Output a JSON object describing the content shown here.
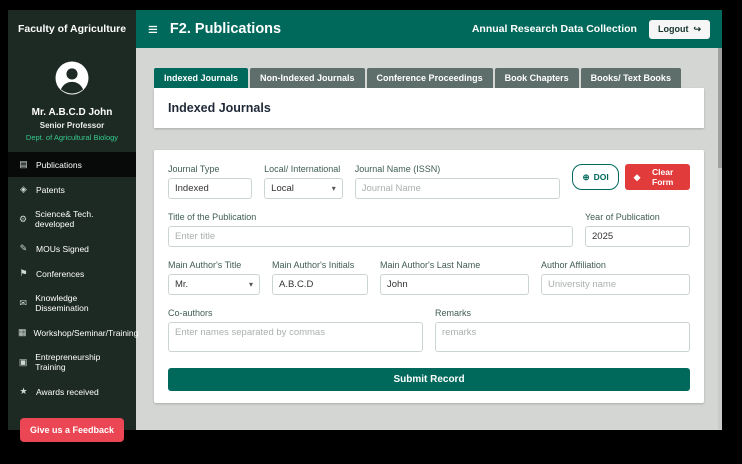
{
  "header": {
    "brand": "Faculty of Agriculture",
    "menu_icon_glyph": "≡",
    "title": "F2. Publications",
    "subtitle": "Annual Research Data Collection",
    "logout": {
      "label": "Logout",
      "icon_glyph": "↪"
    }
  },
  "sidebar": {
    "user": {
      "name": "Mr. A.B.C.D John",
      "role": "Senior Professor",
      "dept": "Dept. of Agricultural Biology"
    },
    "items": [
      {
        "label": "Publications",
        "glyph": "▤"
      },
      {
        "label": "Patents",
        "glyph": "◈"
      },
      {
        "label": "Science& Tech. developed",
        "glyph": "⚙"
      },
      {
        "label": "MOUs Signed",
        "glyph": "✎"
      },
      {
        "label": "Conferences",
        "glyph": "⚑"
      },
      {
        "label": "Knowledge Dissemination",
        "glyph": "✉"
      },
      {
        "label": "Workshop/Seminar/Training",
        "glyph": "▦"
      },
      {
        "label": "Entrepreneurship Training",
        "glyph": "▣"
      },
      {
        "label": "Awards received",
        "glyph": "★"
      }
    ],
    "feedback_label": "Give us a Feedback"
  },
  "tabs": [
    {
      "label": "Indexed Journals"
    },
    {
      "label": "Non-Indexed Journals"
    },
    {
      "label": "Conference Proceedings"
    },
    {
      "label": "Book Chapters"
    },
    {
      "label": "Books/ Text Books"
    }
  ],
  "panel": {
    "title": "Indexed Journals"
  },
  "form": {
    "journal_type": {
      "label": "Journal Type",
      "value": "Indexed"
    },
    "locality": {
      "label": "Local/ International",
      "value": "Local"
    },
    "journal_name": {
      "label": "Journal Name (ISSN)",
      "placeholder": "Journal Name"
    },
    "doi_button": {
      "label": "DOI",
      "icon_glyph": "⊕"
    },
    "clear_button": {
      "label": "Clear Form",
      "icon_glyph": "◆"
    },
    "pub_title": {
      "label": "Title of the Publication",
      "placeholder": "Enter title"
    },
    "year": {
      "label": "Year of Publication",
      "value": "2025"
    },
    "author_title": {
      "label": "Main Author's Title",
      "value": "Mr."
    },
    "author_initials": {
      "label": "Main Author's Initials",
      "value": "A.B.C.D"
    },
    "author_lastname": {
      "label": "Main Author's Last Name",
      "value": "John"
    },
    "affiliation": {
      "label": "Author Affiliation",
      "placeholder": "University name"
    },
    "coauthors": {
      "label": "Co-authors",
      "placeholder": "Enter names separated by commas"
    },
    "remarks": {
      "label": "Remarks",
      "placeholder": "remarks"
    },
    "submit_label": "Submit Record"
  },
  "icons": {
    "chevron_down": "▾"
  },
  "colors": {
    "teal": "#00695c",
    "sidebar_bg": "#1d2a24",
    "active_item_bg": "#070a08",
    "main_bg": "#d4d6d4",
    "inactive_tab": "#5e6e6b",
    "clear_red": "#e23b3b",
    "feedback_red": "#ea4653",
    "dept_green": "#35c98e"
  }
}
